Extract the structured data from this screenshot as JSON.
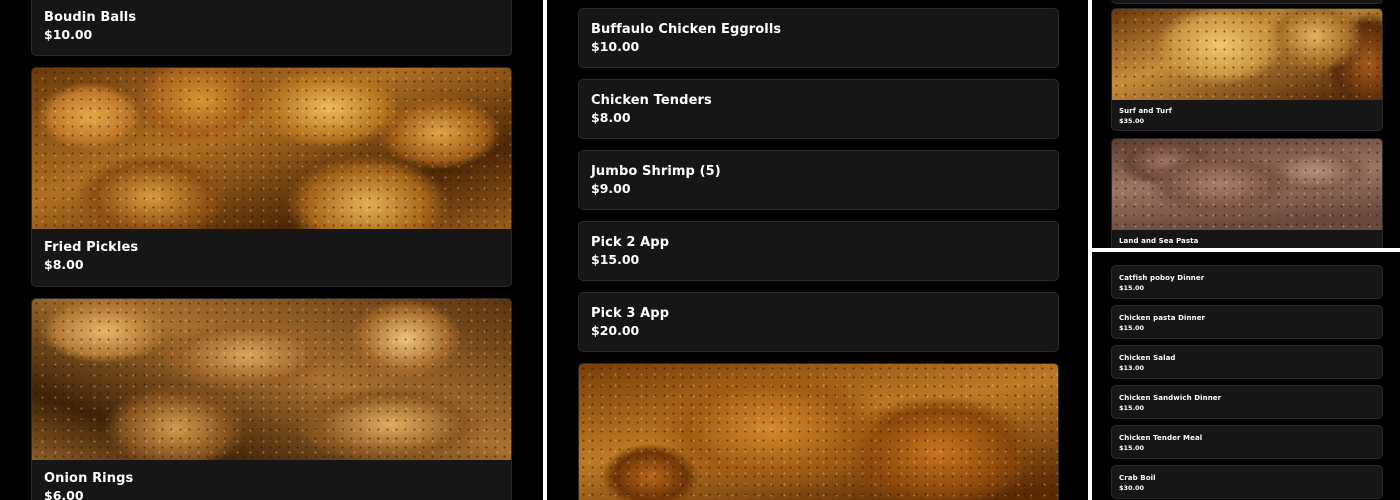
{
  "left_panel": {
    "items": [
      {
        "name": "Boudin Balls",
        "price": "$10.00"
      },
      {
        "name": "Fried Pickles",
        "price": "$8.00",
        "image": "fried-pickles-photo"
      },
      {
        "name": "Onion Rings",
        "price": "$6.00",
        "image": "onion-rings-photo"
      }
    ]
  },
  "middle_panel": {
    "items": [
      {
        "name": "Buffaulo Chicken Eggrolls",
        "price": "$10.00"
      },
      {
        "name": "Chicken Tenders",
        "price": "$8.00"
      },
      {
        "name": "Jumbo Shrimp (5)",
        "price": "$9.00"
      },
      {
        "name": "Pick 2 App",
        "price": "$15.00"
      },
      {
        "name": "Pick 3 App",
        "price": "$20.00"
      }
    ],
    "photo": "chicken-wings-photo"
  },
  "right_top_panel": {
    "items": [
      {
        "name": "Surf and Turf",
        "price": "$35.00",
        "image": "fried-fish-photo"
      },
      {
        "name": "Land and Sea Pasta",
        "price": "",
        "image": "steak-photo"
      }
    ]
  },
  "right_bottom_panel": {
    "items": [
      {
        "name": "Catfish poboy Dinner",
        "price": "$15.00"
      },
      {
        "name": "Chicken pasta Dinner",
        "price": "$15.00"
      },
      {
        "name": "Chicken Salad",
        "price": "$13.00"
      },
      {
        "name": "Chicken Sandwich Dinner",
        "price": "$15.00"
      },
      {
        "name": "Chicken Tender Meal",
        "price": "$15.00"
      },
      {
        "name": "Crab Boil",
        "price": "$30.00"
      }
    ]
  },
  "colors": {
    "background": "#000000",
    "card": "#161616",
    "card_border": "#2a2a2a",
    "text": "#ffffff"
  }
}
